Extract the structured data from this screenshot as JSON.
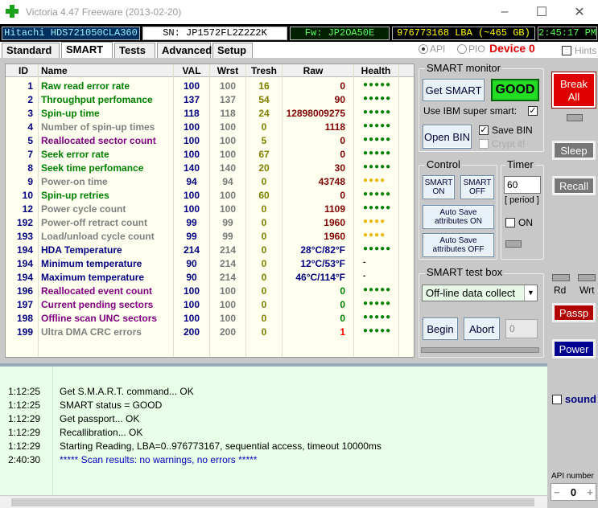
{
  "window": {
    "title": "Victoria 4.47  Freeware (2013-02-20)"
  },
  "info": {
    "model": "Hitachi HDS721050CLA360",
    "serial": "SN: JP1572FL2Z2Z2K",
    "firmware": "Fw: JP2OA50E",
    "lba": "976773168 LBA (~465 GB)",
    "clock": "2:45:17 PM"
  },
  "tabs": [
    "Standard",
    "SMART",
    "Tests",
    "Advanced",
    "Setup"
  ],
  "mode": {
    "api": "API",
    "pio": "PIO",
    "device": "Device 0",
    "hints": "Hints"
  },
  "table": {
    "headers": [
      "ID",
      "Name",
      "VAL",
      "Wrst",
      "Tresh",
      "Raw",
      "Health"
    ],
    "rows": [
      {
        "id": "1",
        "name": "Raw read error rate",
        "val": "100",
        "wrst": "100",
        "tresh": "16",
        "raw": "0",
        "health": "●●●●●",
        "color": "#008000",
        "hcolor": "#008000"
      },
      {
        "id": "2",
        "name": "Throughput perfomance",
        "val": "137",
        "wrst": "137",
        "tresh": "54",
        "raw": "90",
        "health": "●●●●●",
        "color": "#008000",
        "hcolor": "#008000"
      },
      {
        "id": "3",
        "name": "Spin-up time",
        "val": "118",
        "wrst": "118",
        "tresh": "24",
        "raw": "12898009275",
        "health": "●●●●●",
        "color": "#008000",
        "hcolor": "#008000"
      },
      {
        "id": "4",
        "name": "Number of spin-up times",
        "val": "100",
        "wrst": "100",
        "tresh": "0",
        "raw": "1118",
        "health": "●●●●●",
        "color": "#808080",
        "hcolor": "#008000"
      },
      {
        "id": "5",
        "name": "Reallocated sector count",
        "val": "100",
        "wrst": "100",
        "tresh": "5",
        "raw": "0",
        "health": "●●●●●",
        "color": "#800080",
        "hcolor": "#008000"
      },
      {
        "id": "7",
        "name": "Seek error rate",
        "val": "100",
        "wrst": "100",
        "tresh": "67",
        "raw": "0",
        "health": "●●●●●",
        "color": "#008000",
        "hcolor": "#008000"
      },
      {
        "id": "8",
        "name": "Seek time perfomance",
        "val": "140",
        "wrst": "140",
        "tresh": "20",
        "raw": "30",
        "health": "●●●●●",
        "color": "#008000",
        "hcolor": "#008000"
      },
      {
        "id": "9",
        "name": "Power-on time",
        "val": "94",
        "wrst": "94",
        "tresh": "0",
        "raw": "43748",
        "health": "●●●●",
        "color": "#808080",
        "hcolor": "#e8b800"
      },
      {
        "id": "10",
        "name": "Spin-up retries",
        "val": "100",
        "wrst": "100",
        "tresh": "60",
        "raw": "0",
        "health": "●●●●●",
        "color": "#008000",
        "hcolor": "#008000"
      },
      {
        "id": "12",
        "name": "Power cycle count",
        "val": "100",
        "wrst": "100",
        "tresh": "0",
        "raw": "1109",
        "health": "●●●●●",
        "color": "#808080",
        "hcolor": "#008000"
      },
      {
        "id": "192",
        "name": "Power-off retract count",
        "val": "99",
        "wrst": "99",
        "tresh": "0",
        "raw": "1960",
        "health": "●●●●",
        "color": "#808080",
        "hcolor": "#e8b800"
      },
      {
        "id": "193",
        "name": "Load/unload cycle count",
        "val": "99",
        "wrst": "99",
        "tresh": "0",
        "raw": "1960",
        "health": "●●●●",
        "color": "#808080",
        "hcolor": "#e8b800"
      },
      {
        "id": "194",
        "name": "HDA Temperature",
        "val": "214",
        "wrst": "214",
        "tresh": "0",
        "raw": "28°C/82°F",
        "health": "●●●●●",
        "color": "#000080",
        "hcolor": "#008000",
        "rawcolor": "#000080"
      },
      {
        "id": "194",
        "name": "Minimum temperature",
        "val": "90",
        "wrst": "214",
        "tresh": "0",
        "raw": "12°C/53°F",
        "health": "-",
        "color": "#000080",
        "hcolor": "#000000",
        "rawcolor": "#000080"
      },
      {
        "id": "194",
        "name": "Maximum temperature",
        "val": "90",
        "wrst": "214",
        "tresh": "0",
        "raw": "46°C/114°F",
        "health": "-",
        "color": "#000080",
        "hcolor": "#000000",
        "rawcolor": "#000080"
      },
      {
        "id": "196",
        "name": "Reallocated event count",
        "val": "100",
        "wrst": "100",
        "tresh": "0",
        "raw": "0",
        "health": "●●●●●",
        "color": "#800080",
        "hcolor": "#008000",
        "rawcolor": "#008000"
      },
      {
        "id": "197",
        "name": "Current pending sectors",
        "val": "100",
        "wrst": "100",
        "tresh": "0",
        "raw": "0",
        "health": "●●●●●",
        "color": "#800080",
        "hcolor": "#008000",
        "rawcolor": "#008000"
      },
      {
        "id": "198",
        "name": "Offline scan UNC sectors",
        "val": "100",
        "wrst": "100",
        "tresh": "0",
        "raw": "0",
        "health": "●●●●●",
        "color": "#800080",
        "hcolor": "#008000",
        "rawcolor": "#008000"
      },
      {
        "id": "199",
        "name": "Ultra DMA CRC errors",
        "val": "200",
        "wrst": "200",
        "tresh": "0",
        "raw": "1",
        "health": "●●●●●",
        "color": "#808080",
        "hcolor": "#008000",
        "rawcolor": "#ff0000"
      }
    ]
  },
  "smart_monitor": {
    "label": "SMART monitor",
    "get_smart": "Get SMART",
    "status": "GOOD",
    "ibm_label": "Use IBM super smart:",
    "open_bin": "Open BIN",
    "save_bin": "Save BIN",
    "crypt": "Crypt it!"
  },
  "control": {
    "label": "Control",
    "smart_on": "SMART ON",
    "smart_off": "SMART OFF",
    "autosave_on": "Auto Save attributes ON",
    "autosave_off": "Auto Save attributes OFF"
  },
  "timer": {
    "label": "Timer",
    "value": "60",
    "period": "[ period ]",
    "on": "ON"
  },
  "test_box": {
    "label": "SMART test box",
    "selected": "Off-line data collect",
    "begin": "Begin",
    "abort": "Abort",
    "value": "0"
  },
  "side": {
    "break_all": "Break All",
    "sleep": "Sleep",
    "recall": "Recall",
    "rd": "Rd",
    "wrt": "Wrt",
    "passp": "Passp",
    "power": "Power",
    "sound": "sound",
    "api_number": "API number",
    "api_value": "0"
  },
  "log": [
    {
      "time": "1:12:25",
      "msg": "Get S.M.A.R.T. command... OK",
      "color": "#000000"
    },
    {
      "time": "1:12:25",
      "msg": "SMART status = GOOD",
      "color": "#000000"
    },
    {
      "time": "1:12:29",
      "msg": "Get passport... OK",
      "color": "#000000"
    },
    {
      "time": "1:12:29",
      "msg": "Recallibration... OK",
      "color": "#000000"
    },
    {
      "time": "1:12:29",
      "msg": "Starting Reading, LBA=0..976773167, sequential access, timeout 10000ms",
      "color": "#000000"
    },
    {
      "time": "2:40:30",
      "msg": "***** Scan results: no warnings, no errors *****",
      "color": "#0000c0"
    }
  ]
}
